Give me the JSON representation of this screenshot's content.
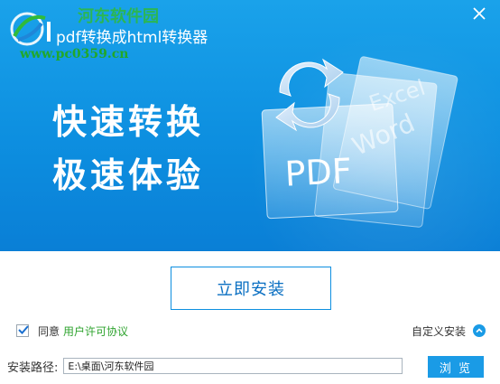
{
  "window": {
    "title": "pdf转换成html转换器",
    "watermark_site": "www.pc0359.cn",
    "watermark_top": "河东软件园"
  },
  "banner": {
    "slogan_line1": "快速转换",
    "slogan_line2": "极速体验",
    "art_labels": {
      "pdf": "PDF",
      "word": "Word",
      "excel": "Excel"
    }
  },
  "install": {
    "button_label": "立即安装"
  },
  "agreement": {
    "checked": true,
    "agree_label": "同意",
    "license_link": "用户许可协议"
  },
  "custom_install": {
    "label": "自定义安装"
  },
  "path": {
    "label": "安装路径:",
    "value": "E:\\桌面\\河东软件园"
  },
  "browse": {
    "label": "浏 览"
  },
  "colors": {
    "banner_blue": "#0d8fe0",
    "accent_blue": "#1a9be6",
    "link_green": "#2ea32e",
    "watermark_green": "#21a829"
  },
  "icons": {
    "close": "close-icon",
    "logo": "app-logo-icon",
    "check": "check-icon",
    "chevron": "chevron-up-icon",
    "refresh": "refresh-arrows-icon"
  }
}
